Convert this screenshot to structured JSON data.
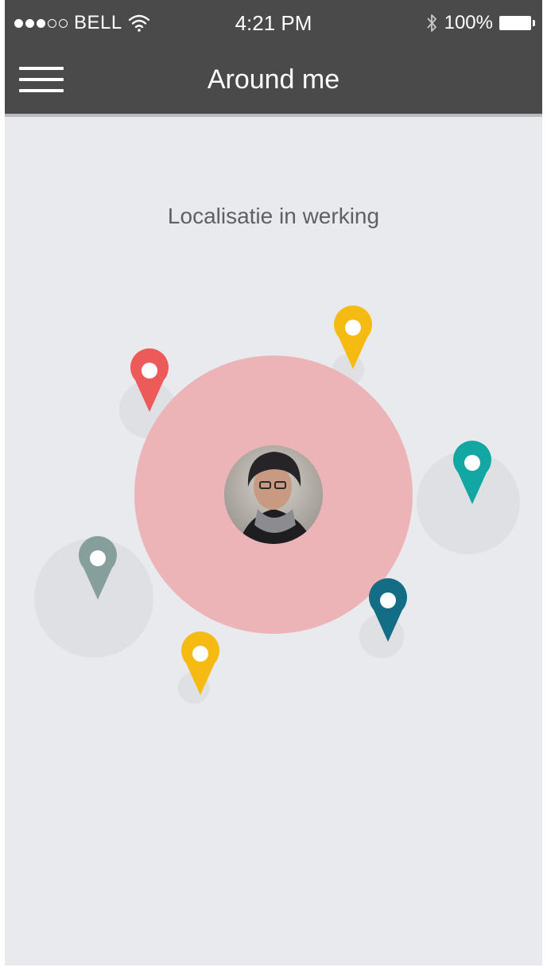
{
  "status_bar": {
    "carrier": "BELL",
    "signal_strength": 3,
    "signal_max": 5,
    "time": "4:21 PM",
    "battery_percent": "100%"
  },
  "nav": {
    "title": "Around me",
    "menu_icon": "hamburger-menu-icon"
  },
  "main": {
    "caption": "Localisatie in werking",
    "user_avatar": "user-avatar-photo",
    "pins": [
      {
        "name": "red-pin",
        "color": "#ec5a5a"
      },
      {
        "name": "yellow-pin-top",
        "color": "#f6bb12"
      },
      {
        "name": "teal-pin",
        "color": "#12a7a2"
      },
      {
        "name": "grey-pin",
        "color": "#869e9c"
      },
      {
        "name": "yellow-pin-bottom",
        "color": "#f6bb12"
      },
      {
        "name": "dark-teal-pin",
        "color": "#136e85"
      }
    ],
    "colors": {
      "range_circle": "#ecb4b6",
      "halo": "#dfe0e3",
      "background": "#e9eaed",
      "header": "#4a4a4a"
    }
  }
}
